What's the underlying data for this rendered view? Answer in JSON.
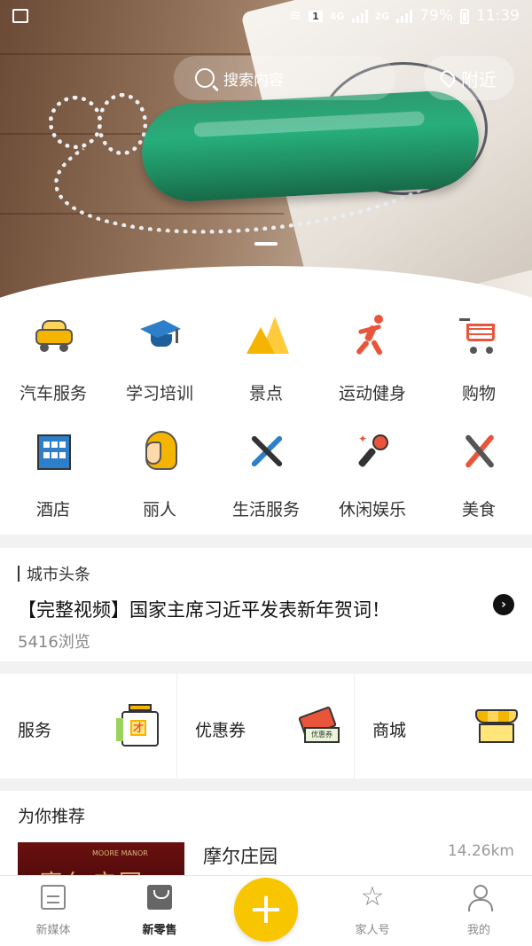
{
  "status_bar": {
    "network": "4G",
    "network2": "2G",
    "battery": "79%",
    "time": "11:39",
    "sim_badge": "1"
  },
  "search": {
    "placeholder": "搜索内容",
    "nearby_label": "附近"
  },
  "categories": [
    {
      "label": "汽车服务",
      "icon": "car-icon"
    },
    {
      "label": "学习培训",
      "icon": "graduation-cap-icon"
    },
    {
      "label": "景点",
      "icon": "mountain-icon"
    },
    {
      "label": "运动健身",
      "icon": "runner-icon"
    },
    {
      "label": "购物",
      "icon": "shopping-cart-icon"
    },
    {
      "label": "酒店",
      "icon": "hotel-building-icon"
    },
    {
      "label": "丽人",
      "icon": "woman-profile-icon"
    },
    {
      "label": "生活服务",
      "icon": "tools-icon"
    },
    {
      "label": "休闲娱乐",
      "icon": "microphone-icon"
    },
    {
      "label": "美食",
      "icon": "fork-knife-icon"
    }
  ],
  "city_news": {
    "section_title": "城市头条",
    "headline": "【完整视频】国家主席习近平发表新年贺词！",
    "views": "5416浏览"
  },
  "shortcuts": [
    {
      "label": "服务",
      "icon": "jar-icon",
      "badge": "才"
    },
    {
      "label": "优惠券",
      "icon": "coupon-icon",
      "badge": "优惠券"
    },
    {
      "label": "商城",
      "icon": "shop-icon"
    }
  ],
  "recommend": {
    "title": "为你推荐",
    "item": {
      "name": "摩尔庄园",
      "distance": "14.26km",
      "thumb_en": "MOORE MANOR",
      "thumb_cn": "摩尔庄园"
    }
  },
  "tabbar": {
    "tabs": [
      {
        "label": "新媒体",
        "icon": "list-doc-icon",
        "active": false
      },
      {
        "label": "新零售",
        "icon": "shopping-bag-icon",
        "active": true
      },
      {
        "label": "家人号",
        "icon": "star-icon",
        "active": false
      },
      {
        "label": "我的",
        "icon": "user-icon",
        "active": false
      }
    ],
    "fab_label": "+"
  },
  "colors": {
    "accent_yellow": "#f7c600",
    "icon_orange": "#e9553a",
    "icon_blue": "#2c7fc8"
  }
}
